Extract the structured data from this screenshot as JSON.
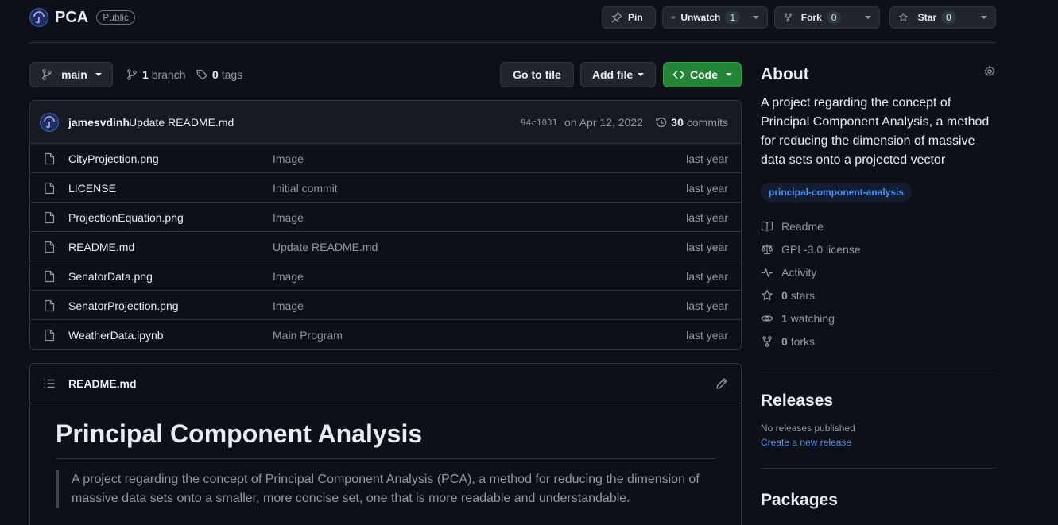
{
  "repo": {
    "name": "PCA",
    "visibility": "Public"
  },
  "header_buttons": {
    "pin": "Pin",
    "unwatch": "Unwatch",
    "unwatch_count": "1",
    "fork": "Fork",
    "fork_count": "0",
    "star": "Star",
    "star_count": "0"
  },
  "branch_bar": {
    "branch": "main",
    "branches_count": "1",
    "branches_label": "branch",
    "tags_count": "0",
    "tags_label": "tags",
    "go_to_file": "Go to file",
    "add_file": "Add file",
    "code": "Code"
  },
  "last_commit": {
    "author": "jamesvdinh",
    "message": "Update README.md",
    "sha": "94c1031",
    "date": "on Apr 12, 2022",
    "commits_count": "30",
    "commits_label": "commits"
  },
  "files": [
    {
      "name": "CityProjection.png",
      "commit": "Image",
      "age": "last year"
    },
    {
      "name": "LICENSE",
      "commit": "Initial commit",
      "age": "last year"
    },
    {
      "name": "ProjectionEquation.png",
      "commit": "Image",
      "age": "last year"
    },
    {
      "name": "README.md",
      "commit": "Update README.md",
      "age": "last year"
    },
    {
      "name": "SenatorData.png",
      "commit": "Image",
      "age": "last year"
    },
    {
      "name": "SenatorProjection.png",
      "commit": "Image",
      "age": "last year"
    },
    {
      "name": "WeatherData.ipynb",
      "commit": "Main Program",
      "age": "last year"
    }
  ],
  "readme": {
    "filename": "README.md",
    "heading": "Principal Component Analysis",
    "quote": "A project regarding the concept of Principal Component Analysis (PCA), a method for reducing the dimension of massive data sets onto a smaller, more concise set, one that is more readable and understandable."
  },
  "about": {
    "title": "About",
    "description": "A project regarding the concept of Principal Component Analysis, a method for reducing the dimension of massive data sets onto a projected vector",
    "topic": "principal-component-analysis",
    "readme": "Readme",
    "license": "GPL-3.0 license",
    "activity": "Activity",
    "stars_count": "0",
    "stars_label": "stars",
    "watching_count": "1",
    "watching_label": "watching",
    "forks_count": "0",
    "forks_label": "forks"
  },
  "releases": {
    "title": "Releases",
    "none": "No releases published",
    "create": "Create a new release"
  },
  "packages": {
    "title": "Packages"
  },
  "colors": {
    "background": "#0d1117",
    "border": "#30363d",
    "accent_link": "#4493f8",
    "button_green": "#238636"
  }
}
